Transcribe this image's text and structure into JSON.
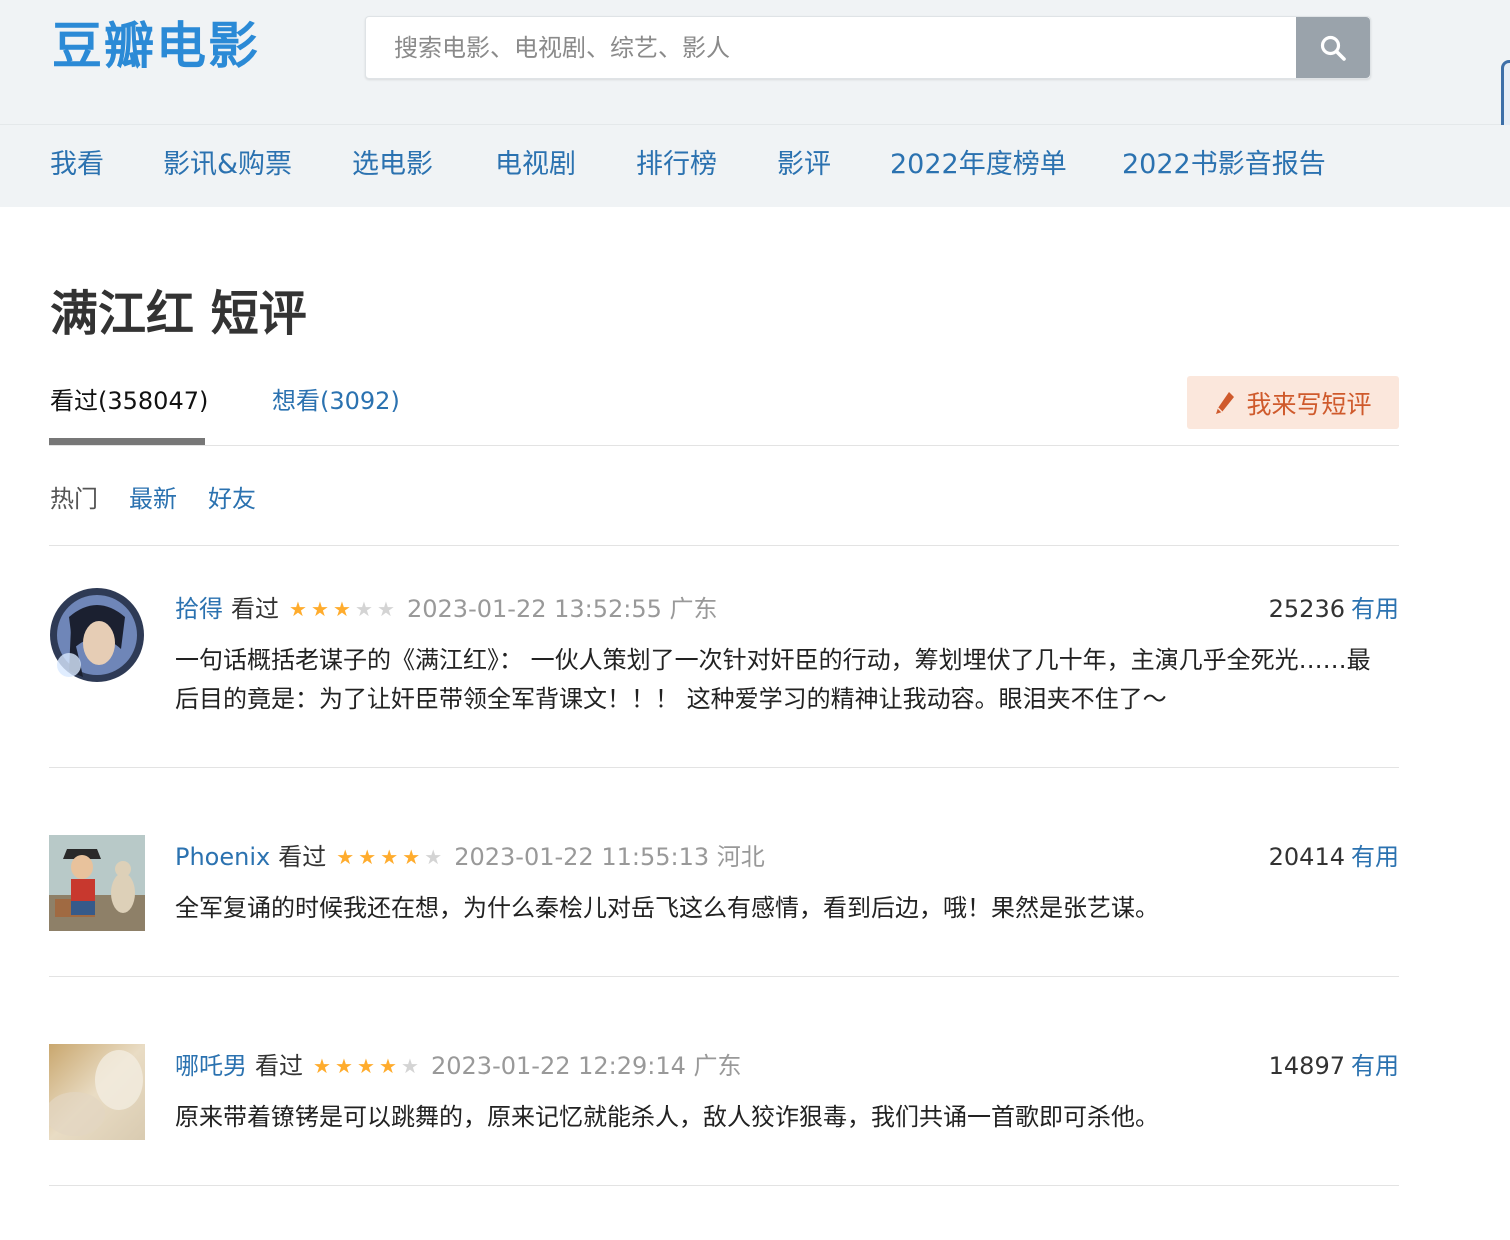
{
  "header": {
    "logo": "豆瓣电影",
    "search_placeholder": "搜索电影、电视剧、综艺、影人",
    "search_icon": "search-icon"
  },
  "nav": {
    "items": [
      {
        "label": "我看"
      },
      {
        "label": "影讯&购票"
      },
      {
        "label": "选电影"
      },
      {
        "label": "电视剧"
      },
      {
        "label": "排行榜"
      },
      {
        "label": "影评"
      },
      {
        "label": "2022年度榜单"
      },
      {
        "label": "2022书影音报告"
      }
    ]
  },
  "page": {
    "title": "满江红 短评",
    "tabs": [
      {
        "label": "看过(358047)",
        "active": true
      },
      {
        "label": "想看(3092)",
        "active": false
      }
    ],
    "write_button": "我来写短评",
    "write_icon": "pencil-icon",
    "filters": [
      "热门",
      "最新",
      "好友"
    ]
  },
  "colors": {
    "link": "#2b72b0",
    "logo": "#2b8ad6",
    "star_on": "#ffac2d",
    "star_off": "#d4d4d4",
    "write_bg": "#fbe7dc",
    "write_text": "#cf5a2c"
  },
  "comments": [
    {
      "user": "拾得",
      "status": "看过",
      "rating": 3,
      "time": "2023-01-22 13:52:55 广东",
      "votes": "25236",
      "useful_label": "有用",
      "content": "一句话概括老谋子的《满江红》： 一伙人策划了一次针对奸臣的行动，筹划埋伏了几十年，主演几乎全死光……最后目的竟是：为了让奸臣带领全军背课文！！！ 这种爱学习的精神让我动容。眼泪夹不住了～"
    },
    {
      "user": "Phoenix",
      "status": "看过",
      "rating": 4,
      "time": "2023-01-22 11:55:13 河北",
      "votes": "20414",
      "useful_label": "有用",
      "content": "全军复诵的时候我还在想，为什么秦桧儿对岳飞这么有感情，看到后边，哦！果然是张艺谋。"
    },
    {
      "user": "哪吒男",
      "status": "看过",
      "rating": 4,
      "time": "2023-01-22 12:29:14 广东",
      "votes": "14897",
      "useful_label": "有用",
      "content": "原来带着镣铐是可以跳舞的，原来记忆就能杀人，敌人狡诈狠毒，我们共诵一首歌即可杀他。"
    }
  ]
}
